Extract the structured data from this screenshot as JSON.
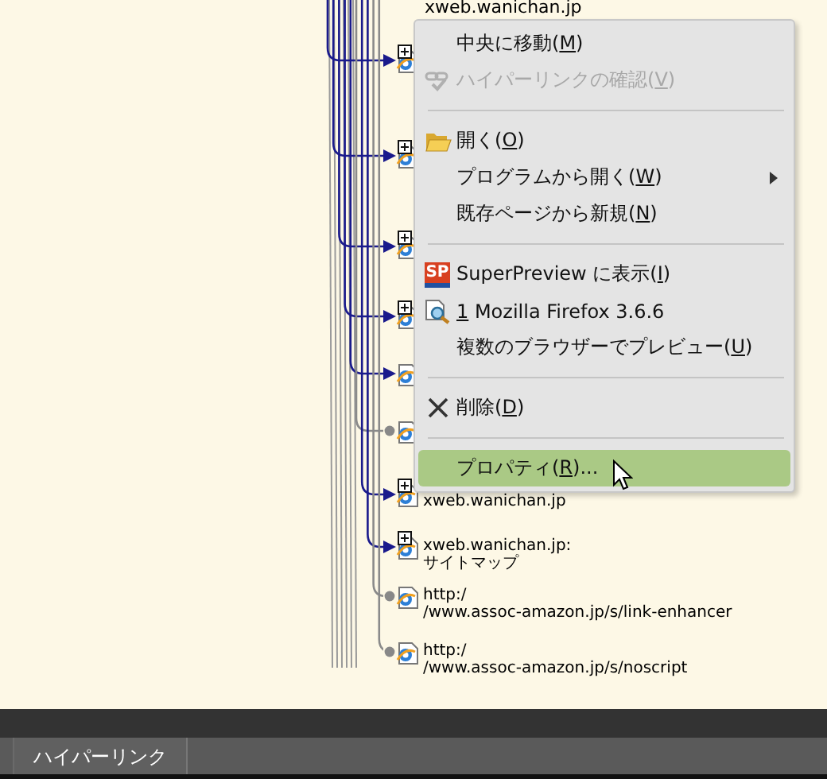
{
  "diagram": {
    "cut_label": "xweb.wanichan.jp",
    "nodes": [
      {
        "kind": "arrow",
        "expandable": true
      },
      {
        "kind": "arrow",
        "expandable": true
      },
      {
        "kind": "arrow",
        "expandable": true
      },
      {
        "kind": "arrow",
        "expandable": true
      },
      {
        "kind": "arrow",
        "expandable": false
      },
      {
        "kind": "dot",
        "expandable": false
      },
      {
        "kind": "arrow",
        "expandable": true,
        "label": [
          "xweb.wanichan.jp"
        ]
      },
      {
        "kind": "arrow",
        "expandable": true,
        "label": [
          "xweb.wanichan.jp:",
          "サイトマップ"
        ]
      },
      {
        "kind": "dot",
        "expandable": false,
        "label": [
          "http:/",
          "/www.assoc-amazon.jp/s/link-enhancer"
        ]
      },
      {
        "kind": "dot",
        "expandable": false,
        "label": [
          "http:/",
          "/www.assoc-amazon.jp/s/noscript"
        ]
      }
    ]
  },
  "context_menu": {
    "items": [
      {
        "kind": "plain",
        "before": "中央に移動(",
        "key": "M",
        "after": ")",
        "disabled": false,
        "selected": false
      },
      {
        "kind": "link-check",
        "before": "ハイパーリンクの確認(",
        "key": "V",
        "after": ")",
        "disabled": true,
        "selected": false
      },
      {
        "kind": "separator"
      },
      {
        "kind": "folder",
        "before": "開く(",
        "key": "O",
        "after": ")",
        "disabled": false,
        "selected": false
      },
      {
        "kind": "submenu",
        "before": "プログラムから開く(",
        "key": "W",
        "after": ")",
        "disabled": false,
        "selected": false
      },
      {
        "kind": "plain",
        "before": "既存ページから新規(",
        "key": "N",
        "after": ")",
        "disabled": false,
        "selected": false
      },
      {
        "kind": "separator"
      },
      {
        "kind": "superpreview",
        "icon_text": "SP",
        "before": "SuperPreview に表示(",
        "key": "I",
        "after": ")",
        "disabled": false,
        "selected": false
      },
      {
        "kind": "browser",
        "key": "1",
        "after": " Mozilla Firefox 3.6.6",
        "disabled": false,
        "selected": false
      },
      {
        "kind": "plain",
        "before": "複数のブラウザーでプレビュー(",
        "key": "U",
        "after": ")",
        "disabled": false,
        "selected": false
      },
      {
        "kind": "separator"
      },
      {
        "kind": "delete",
        "before": "削除(",
        "key": "D",
        "after": ")",
        "disabled": false,
        "selected": false
      },
      {
        "kind": "separator"
      },
      {
        "kind": "plain",
        "before": "プロパティ(",
        "key": "R",
        "after": ")...",
        "disabled": false,
        "selected": true
      }
    ]
  },
  "tabs": [
    {
      "label": "ハイパーリンク",
      "selected": true
    }
  ]
}
